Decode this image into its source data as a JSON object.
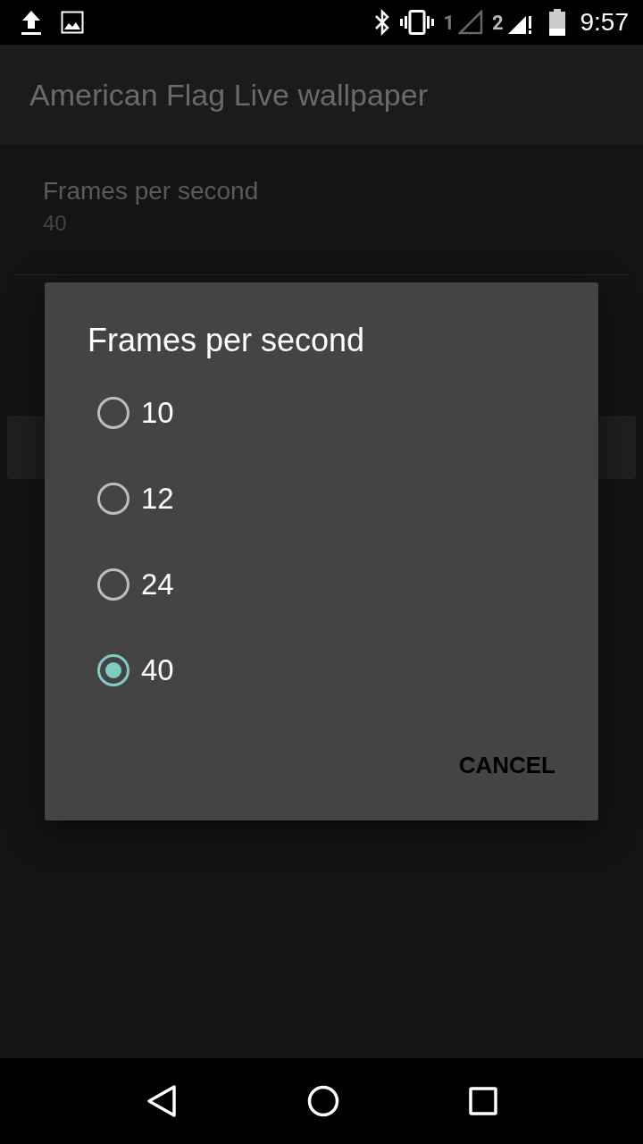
{
  "status_bar": {
    "sim_1": "1",
    "sim_2": "2",
    "time": "9:57"
  },
  "app_bar": {
    "title": "American Flag Live wallpaper"
  },
  "preferences": [
    {
      "title": "Frames per second",
      "summary": "40"
    }
  ],
  "dialog": {
    "title": "Frames per second",
    "options": [
      {
        "label": "10",
        "selected": false
      },
      {
        "label": "12",
        "selected": false
      },
      {
        "label": "24",
        "selected": false
      },
      {
        "label": "40",
        "selected": true
      }
    ],
    "buttons": [
      "CANCEL"
    ]
  }
}
